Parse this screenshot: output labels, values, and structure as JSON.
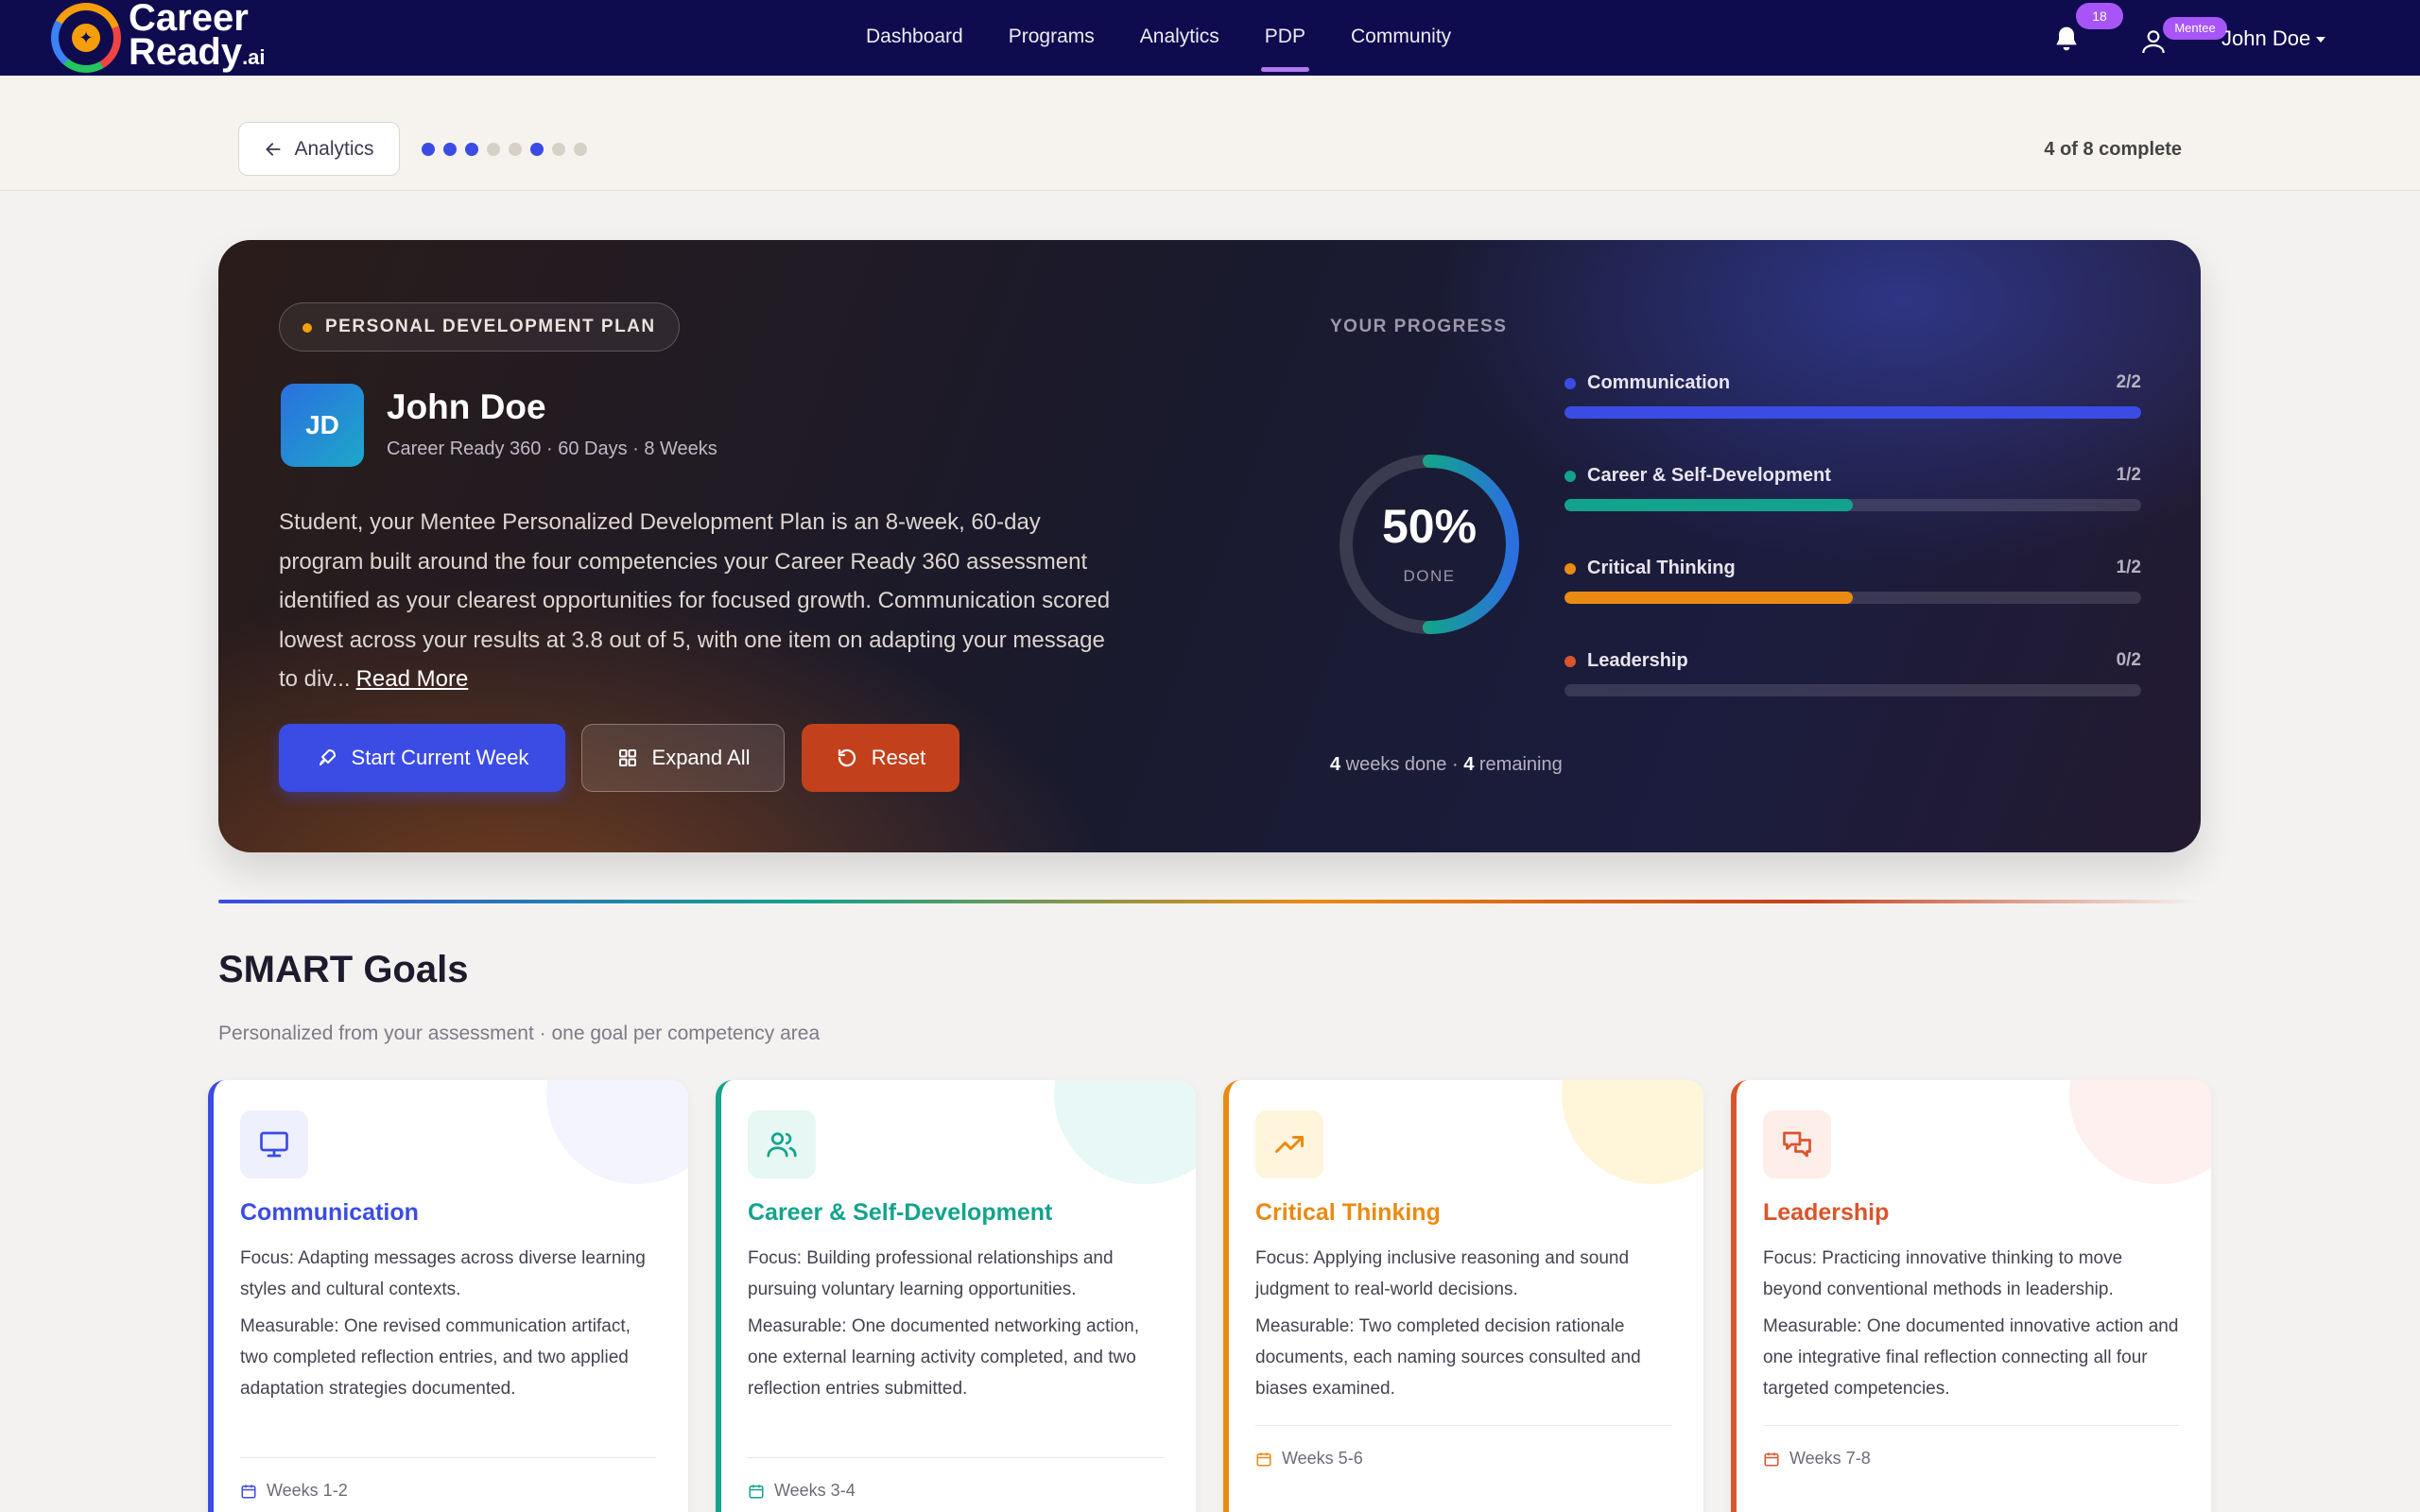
{
  "nav": {
    "logo_line1": "Career",
    "logo_line2": "Ready",
    "logo_suffix": ".ai",
    "links": [
      "Dashboard",
      "Programs",
      "Analytics",
      "PDP",
      "Community"
    ],
    "active": "PDP",
    "notifications_count": "18",
    "role_badge": "Mentee",
    "user_name": "John Doe"
  },
  "subbar": {
    "back_label": "Analytics",
    "step_dots": [
      "#3b4ce5",
      "#3b4ce5",
      "#3b4ce5",
      "#d6d0c6",
      "#d6d0c6",
      "#3b4ce5",
      "#d6d0c6",
      "#d6d0c6"
    ],
    "complete_text": "4 of 8 complete"
  },
  "hero": {
    "pill": "PERSONAL DEVELOPMENT PLAN",
    "initials": "JD",
    "name": "John Doe",
    "subtitle": "Career Ready 360 · 60 Days · 8 Weeks",
    "description": "Student, your Mentee Personalized Development Plan is an 8-week, 60-day program built around the four competencies your Career Ready 360 assessment identified as your clearest opportunities for focused growth. Communication scored lowest across your results at 3.8 out of 5, with one item on adapting your message to div...",
    "read_more": "Read More",
    "btn_start": "Start Current Week",
    "btn_expand": "Expand All",
    "btn_reset": "Reset"
  },
  "progress": {
    "title": "YOUR PROGRESS",
    "percent_label": "50%",
    "percent_value": 0.5,
    "done_label": "DONE",
    "weeks_done": "4",
    "weeks_done_label": " weeks done · ",
    "weeks_remaining": "4",
    "weeks_remaining_label": " remaining",
    "competencies": [
      {
        "name": "Communication",
        "count": "2/2",
        "fraction": 1.0,
        "color": "#3b4ce5"
      },
      {
        "name": "Career & Self-Development",
        "count": "1/2",
        "fraction": 0.5,
        "color": "#13a38c"
      },
      {
        "name": "Critical Thinking",
        "count": "1/2",
        "fraction": 0.5,
        "color": "#ea8a12"
      },
      {
        "name": "Leadership",
        "count": "0/2",
        "fraction": 0.0,
        "color": "#d9552b"
      }
    ]
  },
  "goals": {
    "title": "SMART Goals",
    "subtitle": "Personalized from your assessment · one goal per competency area",
    "cards": [
      {
        "title": "Communication",
        "icon": "monitor-icon",
        "color": "#3b4ce5",
        "icon_bg": "#eef0fd",
        "blob": "#f3f4fd",
        "focus": "Focus: Adapting messages across diverse learning styles and cultural contexts.",
        "measurable": "Measurable: One revised communication artifact, two completed reflection entries, and two applied adaptation strategies documented.",
        "weeks": "Weeks 1-2"
      },
      {
        "title": "Career & Self-Development",
        "icon": "users-icon",
        "color": "#13a38c",
        "icon_bg": "#e6f7f4",
        "blob": "#e7f8f6",
        "focus": "Focus: Building professional relationships and pursuing voluntary learning opportunities.",
        "measurable": "Measurable: One documented networking action, one external learning activity completed, and two reflection entries submitted.",
        "weeks": "Weeks 3-4"
      },
      {
        "title": "Critical Thinking",
        "icon": "trending-up-icon",
        "color": "#ea8a12",
        "icon_bg": "#fff4dc",
        "blob": "#fff6da",
        "focus": "Focus: Applying inclusive reasoning and sound judgment to real-world decisions.",
        "measurable": "Measurable: Two completed decision rationale documents, each naming sources consulted and biases examined.",
        "weeks": "Weeks 5-6"
      },
      {
        "title": "Leadership",
        "icon": "chat-icon",
        "color": "#d9552b",
        "icon_bg": "#fdeeea",
        "blob": "#fdf0ee",
        "focus": "Focus: Practicing innovative thinking to move beyond conventional methods in leadership.",
        "measurable": "Measurable: One documented innovative action and one integrative final reflection connecting all four targeted competencies.",
        "weeks": "Weeks 7-8"
      }
    ]
  }
}
